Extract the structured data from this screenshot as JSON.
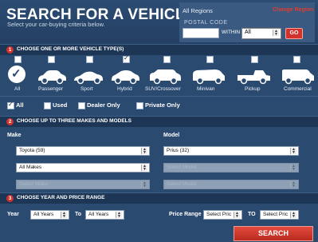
{
  "header": {
    "title": "SEARCH FOR A VEHICLE",
    "subtitle": "Select your car-buying criteria below.",
    "region": "All Regions",
    "change_region": "Change Region",
    "postal_label": "POSTAL CODE",
    "postal_value": "",
    "within_label": "WITHIN",
    "within_value": "All",
    "go_label": "GO"
  },
  "section1": {
    "number": "1",
    "title": "CHOOSE ONE OR MORE VEHICLE TYPE(S)"
  },
  "vehicle_types": [
    {
      "label": "All",
      "checked": false
    },
    {
      "label": "Passenger",
      "checked": false
    },
    {
      "label": "Sport",
      "checked": false
    },
    {
      "label": "Hybrid",
      "checked": true
    },
    {
      "label": "SUV/Crossover",
      "checked": false
    },
    {
      "label": "Minivan",
      "checked": false
    },
    {
      "label": "Pickup",
      "checked": false
    },
    {
      "label": "Commercial",
      "checked": false
    }
  ],
  "conditions": [
    {
      "label": "All",
      "checked": true
    },
    {
      "label": "Used",
      "checked": false
    },
    {
      "label": "Dealer Only",
      "checked": false
    },
    {
      "label": "Private Only",
      "checked": false
    }
  ],
  "section2": {
    "number": "2",
    "title": "CHOOSE UP TO THREE MAKES AND MODELS"
  },
  "make_model": {
    "make_label": "Make",
    "model_label": "Model",
    "rows": [
      {
        "make": "Toyota (59)",
        "model": "Prius (32)",
        "make_enabled": true,
        "model_enabled": true
      },
      {
        "make": "All Makes",
        "model": "Select Model",
        "make_enabled": true,
        "model_enabled": false
      },
      {
        "make": "Select Make",
        "model": "Select Model",
        "make_enabled": false,
        "model_enabled": false
      }
    ]
  },
  "section3": {
    "number": "3",
    "title": "CHOOSE YEAR AND PRICE RANGE"
  },
  "year_price": {
    "year_label": "Year",
    "year_from": "All Years",
    "to_label": "To",
    "year_to": "All Years",
    "price_label": "Price Range",
    "price_from": "Select Pric",
    "price_to_label": "TO",
    "price_to": "Select Pric"
  },
  "search_label": "SEARCH"
}
